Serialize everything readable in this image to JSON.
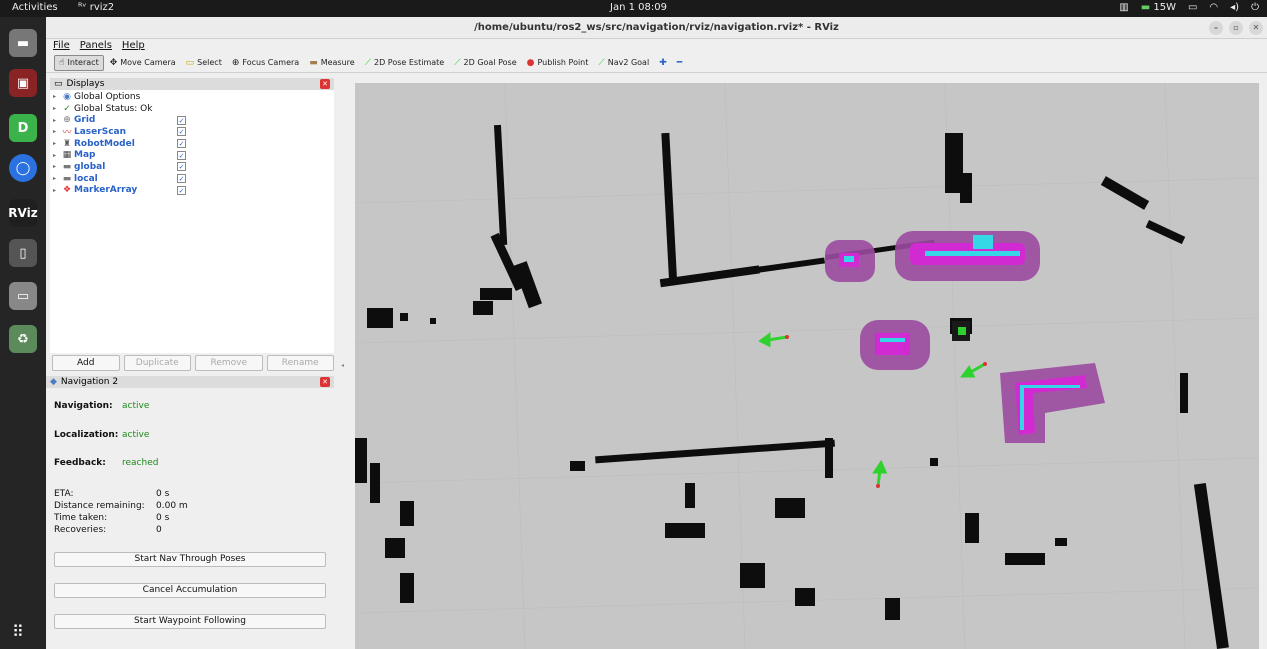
{
  "topbar": {
    "activities": "Activities",
    "app_name": "rviz2",
    "clock": "Jan 1  08:09",
    "power": "15W"
  },
  "dock": {
    "items": [
      "files",
      "terminal",
      "qtcreator",
      "chromium",
      "rviz",
      "tablet",
      "drive",
      "trash"
    ],
    "rviz_label": "RViz",
    "d_label": "D"
  },
  "window": {
    "title": "/home/ubuntu/ros2_ws/src/navigation/rviz/navigation.rviz* - RViz"
  },
  "menu": {
    "file": "File",
    "panels": "Panels",
    "help": "Help"
  },
  "toolbar": {
    "interact": "Interact",
    "move_camera": "Move Camera",
    "select": "Select",
    "focus_camera": "Focus Camera",
    "measure": "Measure",
    "pose_estimate": "2D Pose Estimate",
    "goal_pose": "2D Goal Pose",
    "publish_point": "Publish Point",
    "nav2_goal": "Nav2 Goal"
  },
  "displays": {
    "title": "Displays",
    "items": [
      {
        "label": "Global Options",
        "checked": null
      },
      {
        "label": "Global Status: Ok",
        "checked": null
      },
      {
        "label": "Grid",
        "checked": true
      },
      {
        "label": "LaserScan",
        "checked": true
      },
      {
        "label": "RobotModel",
        "checked": true
      },
      {
        "label": "Map",
        "checked": true
      },
      {
        "label": "global",
        "checked": true
      },
      {
        "label": "local",
        "checked": true
      },
      {
        "label": "MarkerArray",
        "checked": true
      }
    ],
    "buttons": {
      "add": "Add",
      "duplicate": "Duplicate",
      "remove": "Remove",
      "rename": "Rename"
    }
  },
  "nav2": {
    "title": "Navigation 2",
    "navigation_label": "Navigation:",
    "navigation_value": "active",
    "localization_label": "Localization:",
    "localization_value": "active",
    "feedback_label": "Feedback:",
    "feedback_value": "reached",
    "eta_label": "ETA:",
    "eta_value": "0 s",
    "distance_label": "Distance remaining:",
    "distance_value": "0.00 m",
    "time_label": "Time taken:",
    "time_value": "0 s",
    "recoveries_label": "Recoveries:",
    "recoveries_value": "0",
    "btn_through_poses": "Start Nav Through Poses",
    "btn_cancel": "Cancel Accumulation",
    "btn_waypoint": "Start Waypoint Following"
  },
  "colors": {
    "checkbox_blue": "#2a62c8",
    "status_green": "#1e8a1e",
    "costmap_purple": "#9a4aa0",
    "costmap_magenta": "#d22ad2",
    "costmap_cyan": "#35d6e6",
    "arrow_green": "#2fd12f"
  }
}
